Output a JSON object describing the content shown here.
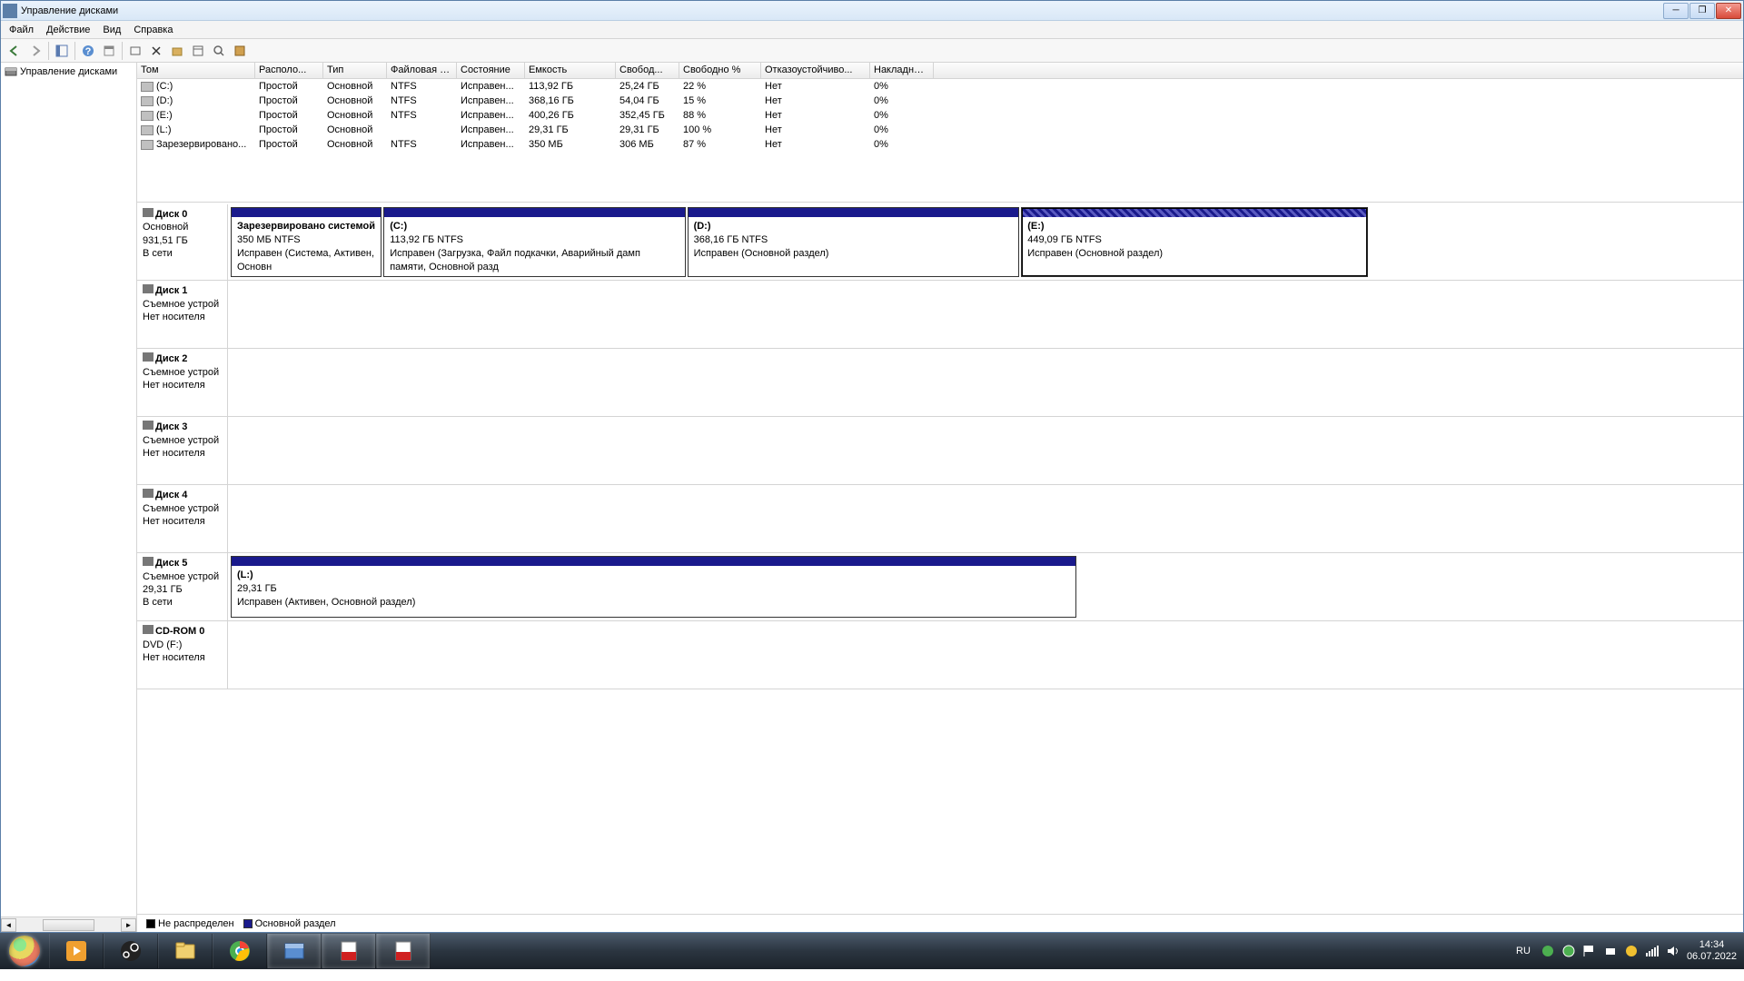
{
  "window": {
    "title": "Управление дисками",
    "tree_root": "Управление дисками"
  },
  "menu": {
    "file": "Файл",
    "action": "Действие",
    "view": "Вид",
    "help": "Справка"
  },
  "columns": {
    "volume": "Том",
    "layout": "Располо...",
    "type": "Тип",
    "fs": "Файловая с...",
    "status": "Состояние",
    "capacity": "Емкость",
    "free": "Свобод...",
    "free_pct": "Свободно %",
    "fault": "Отказоустойчиво...",
    "overhead": "Накладны..."
  },
  "volumes": [
    {
      "name": "(C:)",
      "layout": "Простой",
      "type": "Основной",
      "fs": "NTFS",
      "status": "Исправен...",
      "capacity": "113,92 ГБ",
      "free": "25,24 ГБ",
      "free_pct": "22 %",
      "fault": "Нет",
      "overhead": "0%"
    },
    {
      "name": "(D:)",
      "layout": "Простой",
      "type": "Основной",
      "fs": "NTFS",
      "status": "Исправен...",
      "capacity": "368,16 ГБ",
      "free": "54,04 ГБ",
      "free_pct": "15 %",
      "fault": "Нет",
      "overhead": "0%"
    },
    {
      "name": "(E:)",
      "layout": "Простой",
      "type": "Основной",
      "fs": "NTFS",
      "status": "Исправен...",
      "capacity": "400,26 ГБ",
      "free": "352,45 ГБ",
      "free_pct": "88 %",
      "fault": "Нет",
      "overhead": "0%"
    },
    {
      "name": "(L:)",
      "layout": "Простой",
      "type": "Основной",
      "fs": "",
      "status": "Исправен...",
      "capacity": "29,31 ГБ",
      "free": "29,31 ГБ",
      "free_pct": "100 %",
      "fault": "Нет",
      "overhead": "0%"
    },
    {
      "name": "Зарезервировано...",
      "layout": "Простой",
      "type": "Основной",
      "fs": "NTFS",
      "status": "Исправен...",
      "capacity": "350 МБ",
      "free": "306 МБ",
      "free_pct": "87 %",
      "fault": "Нет",
      "overhead": "0%"
    }
  ],
  "disks": [
    {
      "name": "Диск 0",
      "meta": [
        "Основной",
        "931,51 ГБ",
        "В сети"
      ],
      "partitions": [
        {
          "title": "Зарезервировано системой",
          "sub": "350 МБ NTFS",
          "status": "Исправен (Система, Активен, Основн",
          "widthPct": 10,
          "hatched": false
        },
        {
          "title": "(C:)",
          "sub": "113,92 ГБ NTFS",
          "status": "Исправен (Загрузка, Файл подкачки, Аварийный дамп памяти, Основной разд",
          "widthPct": 20,
          "hatched": false
        },
        {
          "title": "(D:)",
          "sub": "368,16 ГБ NTFS",
          "status": "Исправен (Основной раздел)",
          "widthPct": 22,
          "hatched": false
        },
        {
          "title": "(E:)",
          "sub": "449,09 ГБ NTFS",
          "status": "Исправен (Основной раздел)",
          "widthPct": 23,
          "hatched": true,
          "selected": true
        }
      ]
    },
    {
      "name": "Диск 1",
      "meta": [
        "Съемное устрой",
        "",
        "Нет носителя"
      ],
      "partitions": []
    },
    {
      "name": "Диск 2",
      "meta": [
        "Съемное устрой",
        "",
        "Нет носителя"
      ],
      "partitions": []
    },
    {
      "name": "Диск 3",
      "meta": [
        "Съемное устрой",
        "",
        "Нет носителя"
      ],
      "partitions": []
    },
    {
      "name": "Диск 4",
      "meta": [
        "Съемное устрой",
        "",
        "Нет носителя"
      ],
      "partitions": []
    },
    {
      "name": "Диск 5",
      "meta": [
        "Съемное устрой",
        "29,31 ГБ",
        "В сети"
      ],
      "partitions": [
        {
          "title": "(L:)",
          "sub": "29,31 ГБ",
          "status": "Исправен (Активен, Основной раздел)",
          "widthPct": 56,
          "hatched": false
        }
      ]
    },
    {
      "name": "CD-ROM 0",
      "meta": [
        "DVD (F:)",
        "",
        "Нет носителя"
      ],
      "partitions": [],
      "cdrom": true
    }
  ],
  "legend": {
    "unallocated": "Не распределен",
    "primary": "Основной раздел"
  },
  "taskbar": {
    "lang": "RU",
    "time": "14:34",
    "date": "06.07.2022"
  }
}
